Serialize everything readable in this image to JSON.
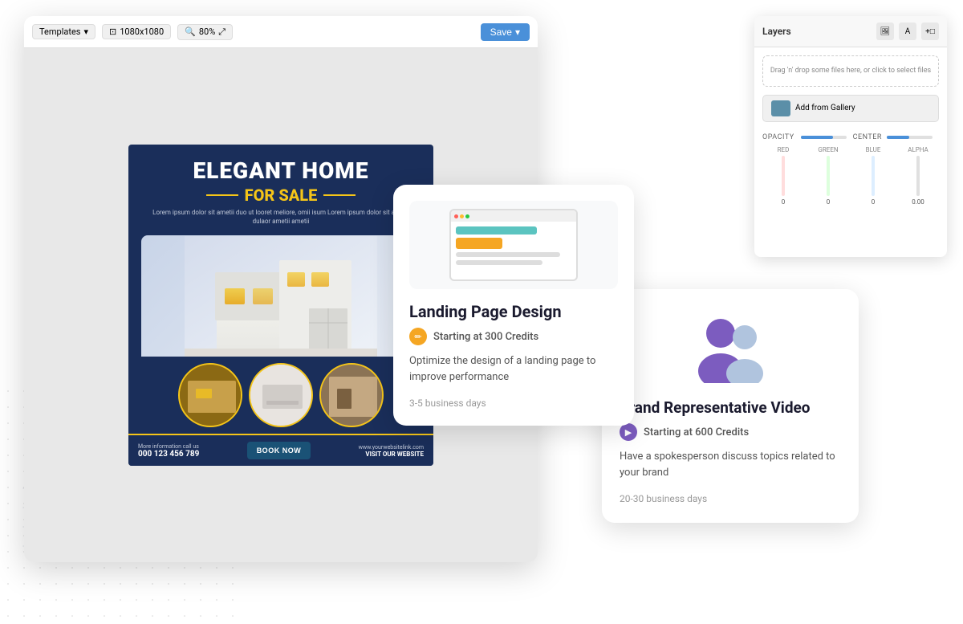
{
  "editor": {
    "toolbar": {
      "templates_label": "Templates",
      "size_label": "1080x1080",
      "zoom_label": "80%",
      "save_label": "Save",
      "dropdown_arrow": "▾"
    },
    "layers_panel": {
      "title": "Layers",
      "upload_text": "Drag 'n' drop some files here, or click to select files",
      "add_gallery_label": "Add from Gallery",
      "opacity_label": "OPACITY",
      "center_label": "CENTER",
      "red_label": "RED",
      "green_label": "GREEN",
      "blue_label": "BLUE",
      "alpha_label": "ALPHA",
      "alpha_value": "0.00"
    }
  },
  "flyer": {
    "title_line1": "ELEGANT HOME",
    "subtitle": "FOR SALE",
    "description": "Lorem ipsum dolor sit ametii duo ut looret meliore, omii isum\nLorem ipsum dolor sit ametii dulaor ametii ametii",
    "contact_label": "More information call us",
    "phone": "000 123 456 789",
    "cta_button": "BOOK NOW",
    "website": "www.yourwebsitelink.com",
    "website_cta": "VISIT OUR WEBSITE"
  },
  "landing_card": {
    "title": "Landing Page Design",
    "credits_text": "Starting at 300 Credits",
    "description": "Optimize the design of a landing page to improve performance",
    "days": "3-5 business days"
  },
  "brand_card": {
    "title": "Brand Representative Video",
    "credits_text": "Starting at 600 Credits",
    "description": "Have a spokesperson discuss topics related to your brand",
    "days": "20-30 business days"
  }
}
